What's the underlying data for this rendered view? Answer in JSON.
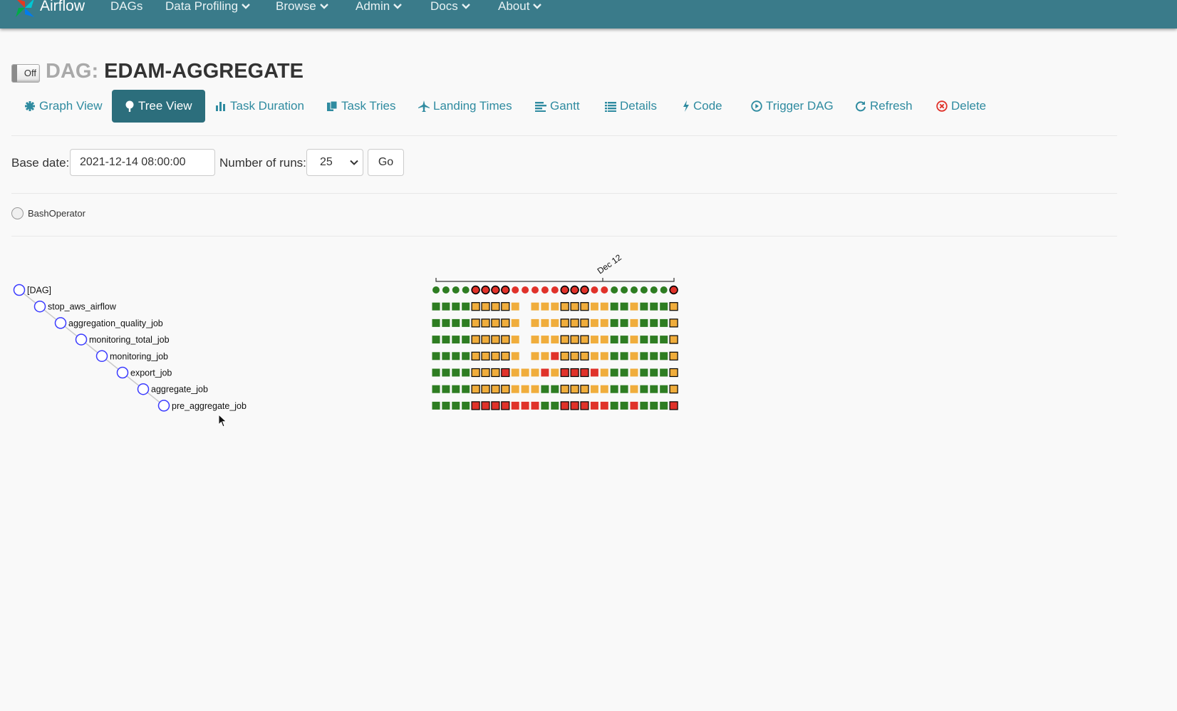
{
  "navbar": {
    "brand": "Airflow",
    "items": [
      {
        "label": "DAGs",
        "dropdown": false
      },
      {
        "label": "Data Profiling",
        "dropdown": true
      },
      {
        "label": "Browse",
        "dropdown": true
      },
      {
        "label": "Admin",
        "dropdown": true
      },
      {
        "label": "Docs",
        "dropdown": true
      },
      {
        "label": "About",
        "dropdown": true
      }
    ]
  },
  "dag": {
    "toggle_label": "Off",
    "title_prefix": "DAG:",
    "title": "EDAM-AGGREGATE"
  },
  "tabs": [
    {
      "label": "Graph View",
      "icon": "asterisk-icon",
      "active": false
    },
    {
      "label": "Tree View",
      "icon": "tree-icon",
      "active": true
    },
    {
      "label": "Task Duration",
      "icon": "bar-chart-icon",
      "active": false
    },
    {
      "label": "Task Tries",
      "icon": "copy-icon",
      "active": false
    },
    {
      "label": "Landing Times",
      "icon": "plane-icon",
      "active": false
    },
    {
      "label": "Gantt",
      "icon": "align-left-icon",
      "active": false
    },
    {
      "label": "Details",
      "icon": "list-icon",
      "active": false
    },
    {
      "label": "Code",
      "icon": "flash-icon",
      "active": false
    },
    {
      "label": "Trigger DAG",
      "icon": "play-circle-icon",
      "active": false
    },
    {
      "label": "Refresh",
      "icon": "refresh-icon",
      "active": false
    },
    {
      "label": "Delete",
      "icon": "remove-circle-icon",
      "active": false
    }
  ],
  "form": {
    "base_date_label": "Base date:",
    "base_date_value": "2021-12-14 08:00:00",
    "num_runs_label": "Number of runs:",
    "num_runs_value": "25",
    "go_label": "Go"
  },
  "legend": {
    "operator": "BashOperator"
  },
  "tree": {
    "date_label": "Dec 12",
    "nodes": [
      "[DAG]",
      "stop_aws_airflow",
      "aggregation_quality_job",
      "monitoring_total_job",
      "monitoring_job",
      "export_job",
      "aggregate_job",
      "pre_aggregate_job"
    ],
    "status_colors": {
      "success": "#2e7d22",
      "failed": "#e0322a",
      "upstream_failed": "#f0ad3c"
    },
    "runs": [
      "s",
      "s",
      "s",
      "s",
      "F",
      "F",
      "F",
      "F",
      "f",
      "f",
      "f",
      "f",
      "f",
      "F",
      "F",
      "F",
      "f",
      "f",
      "s",
      "s",
      "s",
      "s",
      "s",
      "s",
      "F"
    ],
    "tasks": [
      [
        "s",
        "s",
        "s",
        "s",
        "U",
        "U",
        "U",
        "U",
        "u",
        "n",
        "u",
        "u",
        "u",
        "U",
        "U",
        "U",
        "u",
        "u",
        "s",
        "s",
        "u",
        "s",
        "s",
        "s",
        "U"
      ],
      [
        "s",
        "s",
        "s",
        "s",
        "U",
        "U",
        "U",
        "U",
        "u",
        "n",
        "u",
        "u",
        "u",
        "U",
        "U",
        "U",
        "u",
        "u",
        "s",
        "s",
        "u",
        "s",
        "s",
        "s",
        "U"
      ],
      [
        "s",
        "s",
        "s",
        "s",
        "U",
        "U",
        "U",
        "U",
        "u",
        "n",
        "u",
        "u",
        "u",
        "U",
        "U",
        "U",
        "u",
        "u",
        "s",
        "s",
        "u",
        "s",
        "s",
        "s",
        "U"
      ],
      [
        "s",
        "s",
        "s",
        "s",
        "U",
        "U",
        "U",
        "U",
        "u",
        "n",
        "u",
        "u",
        "f",
        "U",
        "U",
        "U",
        "u",
        "u",
        "s",
        "s",
        "u",
        "s",
        "s",
        "s",
        "U"
      ],
      [
        "s",
        "s",
        "s",
        "s",
        "U",
        "U",
        "U",
        "F",
        "u",
        "u",
        "u",
        "f",
        "u",
        "F",
        "F",
        "F",
        "f",
        "u",
        "s",
        "s",
        "u",
        "s",
        "s",
        "s",
        "U"
      ],
      [
        "s",
        "s",
        "s",
        "s",
        "U",
        "U",
        "U",
        "U",
        "u",
        "u",
        "u",
        "s",
        "s",
        "U",
        "U",
        "U",
        "u",
        "u",
        "s",
        "s",
        "u",
        "s",
        "s",
        "s",
        "U"
      ],
      [
        "s",
        "s",
        "s",
        "s",
        "F",
        "F",
        "F",
        "F",
        "f",
        "f",
        "f",
        "s",
        "s",
        "F",
        "F",
        "F",
        "f",
        "f",
        "s",
        "s",
        "f",
        "s",
        "s",
        "s",
        "F"
      ]
    ]
  }
}
